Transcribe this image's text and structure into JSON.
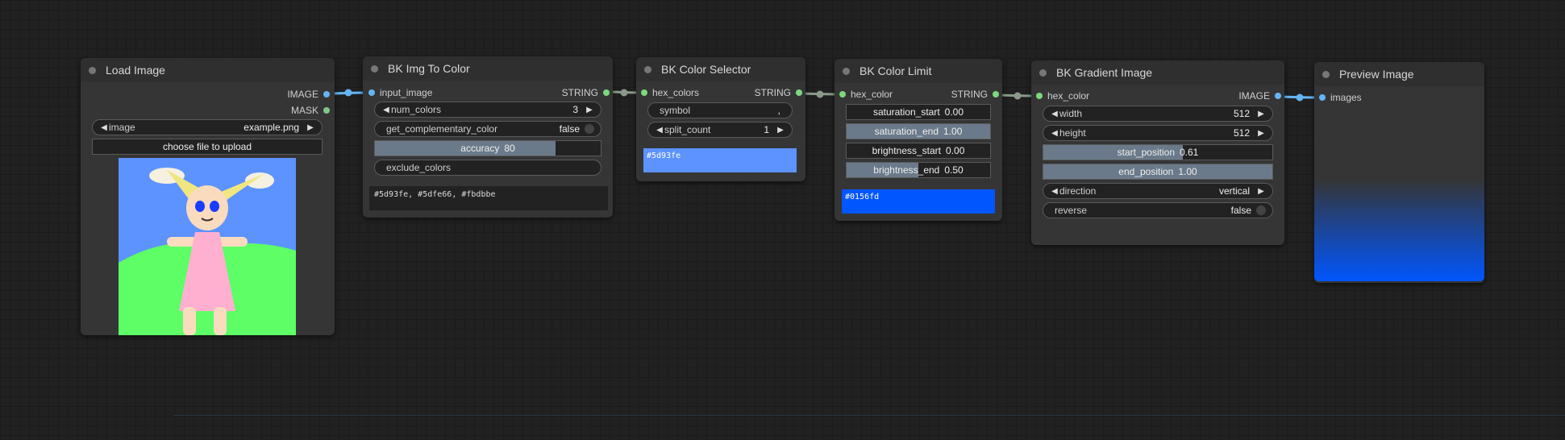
{
  "colors": {
    "canvas_bg": "#212121",
    "node_bg": "#353535",
    "image_link": "#64b5f6",
    "string_link": "#7cd87c",
    "mask_slot": "#81c784",
    "swatch_selector": "#5d93fe",
    "swatch_limit": "#0156fd",
    "gradient_top": "#353535",
    "gradient_bottom": "#0156fd"
  },
  "nodes": {
    "load_image": {
      "title": "Load Image",
      "outputs": [
        "IMAGE",
        "MASK"
      ],
      "image_label": "image",
      "image_value": "example.png",
      "upload_label": "choose file to upload",
      "preview_icon": "cartoon-girl-image"
    },
    "img_to_color": {
      "title": "BK Img To Color",
      "input": "input_image",
      "output": "STRING",
      "num_colors_label": "num_colors",
      "num_colors_value": "3",
      "complementary_label": "get_complementary_color",
      "complementary_value": "false",
      "accuracy_label": "accuracy",
      "accuracy_value": "80",
      "accuracy_fill": 0.8,
      "exclude_label": "exclude_colors",
      "result_text": "#5d93fe, #5dfe66, #fbdbbe"
    },
    "color_selector": {
      "title": "BK Color Selector",
      "input": "hex_colors",
      "output": "STRING",
      "symbol_label": "symbol",
      "symbol_value": ",",
      "split_label": "split_count",
      "split_value": "1",
      "result_text": "#5d93fe"
    },
    "color_limit": {
      "title": "BK Color Limit",
      "input": "hex_color",
      "output": "STRING",
      "sat_start_label": "saturation_start",
      "sat_start_value": "0.00",
      "sat_start_fill": 0.0,
      "sat_end_label": "saturation_end",
      "sat_end_value": "1.00",
      "sat_end_fill": 1.0,
      "bri_start_label": "brightness_start",
      "bri_start_value": "0.00",
      "bri_start_fill": 0.0,
      "bri_end_label": "brightness_end",
      "bri_end_value": "0.50",
      "bri_end_fill": 0.5,
      "result_text": "#0156fd"
    },
    "gradient_image": {
      "title": "BK Gradient Image",
      "input": "hex_color",
      "output": "IMAGE",
      "width_label": "width",
      "width_value": "512",
      "height_label": "height",
      "height_value": "512",
      "start_label": "start_position",
      "start_value": "0.61",
      "start_fill": 0.61,
      "end_label": "end_position",
      "end_value": "1.00",
      "end_fill": 1.0,
      "direction_label": "direction",
      "direction_value": "vertical",
      "reverse_label": "reverse",
      "reverse_value": "false"
    },
    "preview": {
      "title": "Preview Image",
      "input": "images"
    }
  }
}
